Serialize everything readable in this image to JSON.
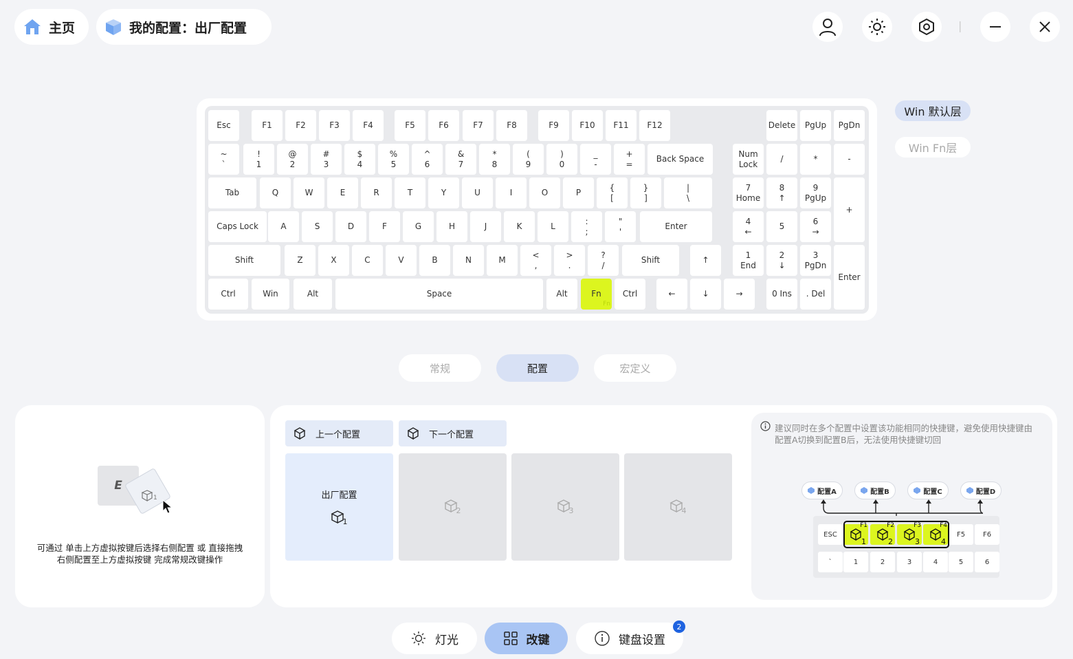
{
  "header": {
    "home_label": "主页",
    "config_label": "我的配置：出厂配置",
    "icons": [
      "user-icon",
      "brightness-icon",
      "settings-hex-icon",
      "minimize-icon",
      "close-icon"
    ],
    "separator": "|"
  },
  "keyboard": {
    "rows": [
      [
        "Esc",
        "F1",
        "F2",
        "F3",
        "F4",
        "F5",
        "F6",
        "F7",
        "F8",
        "F9",
        "F10",
        "F11",
        "F12",
        "Delete",
        "PgUp",
        "PgDn"
      ],
      [
        "~\n`",
        "!\n1",
        "@\n2",
        "#\n3",
        "$\n4",
        "%\n5",
        "^\n6",
        "&\n7",
        "*\n8",
        "(\n9",
        ")\n0",
        "_\n-",
        "+\n=",
        "Back Space",
        "Num\nLock",
        "/",
        "*",
        "-"
      ],
      [
        "Tab",
        "Q",
        "W",
        "E",
        "R",
        "T",
        "Y",
        "U",
        "I",
        "O",
        "P",
        "{\n[",
        "}\n]",
        "|\n\\",
        "7\nHome",
        "8\n↑",
        "9\nPgUp",
        "+"
      ],
      [
        "Caps Lock",
        "A",
        "S",
        "D",
        "F",
        "G",
        "H",
        "J",
        "K",
        "L",
        ":\n;",
        "\"\n'",
        "Enter",
        "4\n←",
        "5",
        "6\n→"
      ],
      [
        "Shift",
        "Z",
        "X",
        "C",
        "V",
        "B",
        "N",
        "M",
        "<\n,",
        ">\n.",
        "?\n/",
        "Shift",
        "↑",
        "1\nEnd",
        "2\n↓",
        "3\nPgDn",
        "Enter"
      ],
      [
        "Ctrl",
        "Win",
        "Alt",
        "Space",
        "Alt",
        "Fn",
        "Ctrl",
        "←",
        "↓",
        "→",
        "0 Ins",
        ". Del"
      ]
    ],
    "highlighted_key": "Fn",
    "highlighted_sublabel": "Fn",
    "highlight_color": "#dcf51f"
  },
  "layers": {
    "active": "Win 默认层",
    "inactive": "Win Fn层"
  },
  "mode_tabs": [
    {
      "label": "常规",
      "active": false
    },
    {
      "label": "配置",
      "active": true
    },
    {
      "label": "宏定义",
      "active": false
    }
  ],
  "left_panel": {
    "key_letter": "E",
    "instruction_line1": "可通过 单击上方虚拟按键后选择右侧配置 或 直接拖拽",
    "instruction_line2": "右侧配置至上方虚拟按键 完成常规改键操作"
  },
  "config_panel": {
    "prev_label": "上一个配置",
    "next_label": "下一个配置",
    "slots": [
      {
        "name": "出厂配置",
        "index": "1",
        "active": true
      },
      {
        "name": "",
        "index": "2",
        "active": false
      },
      {
        "name": "",
        "index": "3",
        "active": false
      },
      {
        "name": "",
        "index": "4",
        "active": false
      }
    ]
  },
  "tip_panel": {
    "tip_line1": "建议同时在多个配置中设置该功能相同的快捷键，避免使用快捷键由",
    "tip_line2": "配置A切换到配置B后，无法使用快捷键切回",
    "configs": [
      "配置A",
      "配置B",
      "配置C",
      "配置D"
    ],
    "row1": [
      "ESC",
      "F1",
      "F2",
      "F3",
      "F4",
      "F5",
      "F6"
    ],
    "row2": [
      "`",
      "1",
      "2",
      "3",
      "4",
      "5",
      "6"
    ],
    "fkey_labels": [
      "F1",
      "F2",
      "F3",
      "F4"
    ],
    "fkey_index": [
      "1",
      "2",
      "3",
      "4"
    ]
  },
  "bottom_nav": [
    {
      "label": "灯光",
      "active": false,
      "icon": "light-icon"
    },
    {
      "label": "改键",
      "active": true,
      "icon": "remap-grid-icon"
    },
    {
      "label": "键盘设置",
      "active": false,
      "icon": "info-icon",
      "badge": "2"
    }
  ],
  "colors": {
    "accent": "#a9c5f4",
    "tab_active": "#d8e1f5",
    "badge": "#1f63e0",
    "highlight": "#dcf51f"
  }
}
